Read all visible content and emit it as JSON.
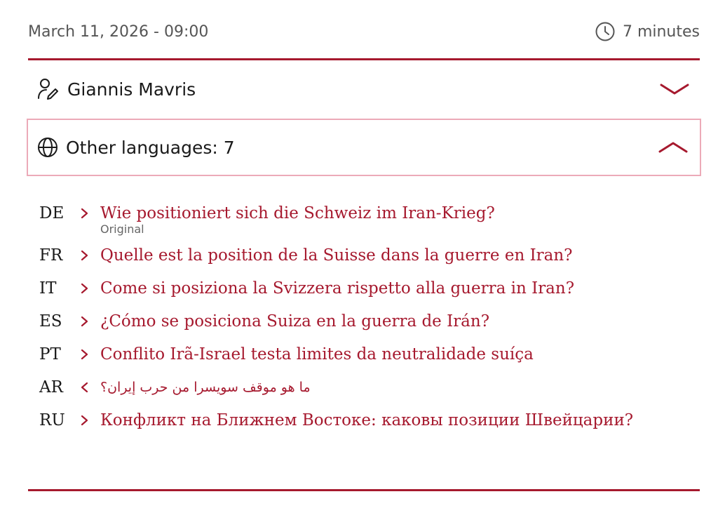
{
  "meta": {
    "date": "March 11, 2026 - 09:00",
    "read_time": "7 minutes",
    "clock_icon": "clock-icon"
  },
  "author": {
    "name": "Giannis Mavris",
    "icon": "author-icon",
    "expanded": false,
    "toggle_icon": "chevron-down-icon"
  },
  "languages": {
    "label": "Other languages: 7",
    "icon": "globe-icon",
    "expanded": true,
    "toggle_icon": "chevron-up-icon",
    "items": [
      {
        "code": "DE",
        "title": "Wie positioniert sich die Schweiz im Iran-Krieg?",
        "note": "Original"
      },
      {
        "code": "FR",
        "title": "Quelle est la position de la Suisse dans la guerre en Iran?"
      },
      {
        "code": "IT",
        "title": "Come si posiziona la Svizzera rispetto alla guerra in Iran?"
      },
      {
        "code": "ES",
        "title": "¿Cómo se posiciona Suiza en la guerra de Irán?"
      },
      {
        "code": "PT",
        "title": "Conflito Irã-Israel testa limites da neutralidade suíça"
      },
      {
        "code": "AR",
        "title": "ما هو موقف سويسرا من حرب إيران؟",
        "rtl": true
      },
      {
        "code": "RU",
        "title": "Конфликт на Ближнем Востоке: каковы позиции Швейцарии?"
      }
    ]
  },
  "colors": {
    "accent": "#a6192e",
    "focus_border": "#ecaab8",
    "meta_text": "#555555"
  }
}
